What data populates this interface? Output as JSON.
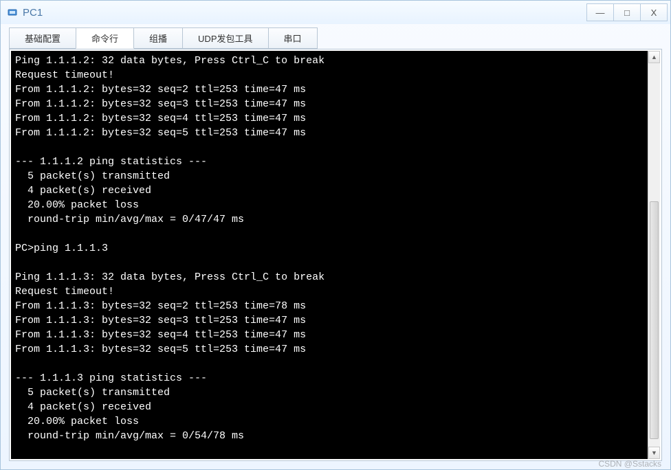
{
  "window": {
    "title": "PC1",
    "controls": {
      "minimize": "—",
      "maximize": "□",
      "close": "X"
    }
  },
  "tabs": [
    {
      "label": "基础配置",
      "active": false
    },
    {
      "label": "命令行",
      "active": true
    },
    {
      "label": "组播",
      "active": false
    },
    {
      "label": "UDP发包工具",
      "active": false
    },
    {
      "label": "串口",
      "active": false
    }
  ],
  "terminal_lines": [
    "Ping 1.1.1.2: 32 data bytes, Press Ctrl_C to break",
    "Request timeout!",
    "From 1.1.1.2: bytes=32 seq=2 ttl=253 time=47 ms",
    "From 1.1.1.2: bytes=32 seq=3 ttl=253 time=47 ms",
    "From 1.1.1.2: bytes=32 seq=4 ttl=253 time=47 ms",
    "From 1.1.1.2: bytes=32 seq=5 ttl=253 time=47 ms",
    "",
    "--- 1.1.1.2 ping statistics ---",
    "  5 packet(s) transmitted",
    "  4 packet(s) received",
    "  20.00% packet loss",
    "  round-trip min/avg/max = 0/47/47 ms",
    "",
    "PC>ping 1.1.1.3",
    "",
    "Ping 1.1.1.3: 32 data bytes, Press Ctrl_C to break",
    "Request timeout!",
    "From 1.1.1.3: bytes=32 seq=2 ttl=253 time=78 ms",
    "From 1.1.1.3: bytes=32 seq=3 ttl=253 time=47 ms",
    "From 1.1.1.3: bytes=32 seq=4 ttl=253 time=47 ms",
    "From 1.1.1.3: bytes=32 seq=5 ttl=253 time=47 ms",
    "",
    "--- 1.1.1.3 ping statistics ---",
    "  5 packet(s) transmitted",
    "  4 packet(s) received",
    "  20.00% packet loss",
    "  round-trip min/avg/max = 0/54/78 ms"
  ],
  "scrollbar": {
    "up_glyph": "▲",
    "down_glyph": "▼"
  },
  "watermark": "CSDN @Sstacks"
}
